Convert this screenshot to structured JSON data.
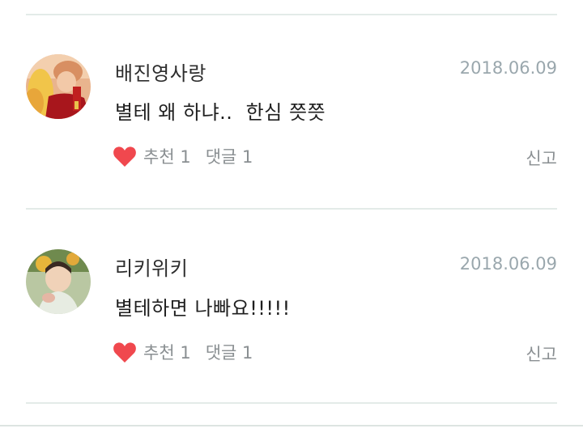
{
  "comments": [
    {
      "username": "배진영사랑",
      "date": "2018.06.09",
      "text": "별테 왜 하냐..  한심 쯧쯧",
      "like_label": "추천 1",
      "reply_label": "댓글 1",
      "report_label": "신고",
      "like_icon": "heart-icon"
    },
    {
      "username": "리키위키",
      "date": "2018.06.09",
      "text": "별테하면 나빠요!!!!!",
      "like_label": "추천 1",
      "reply_label": "댓글 1",
      "report_label": "신고",
      "like_icon": "heart-icon"
    }
  ],
  "colors": {
    "heart": "#f0484e",
    "divider": "#e3ebe8",
    "date": "#9aa7ad",
    "meta": "#8a8f92"
  }
}
